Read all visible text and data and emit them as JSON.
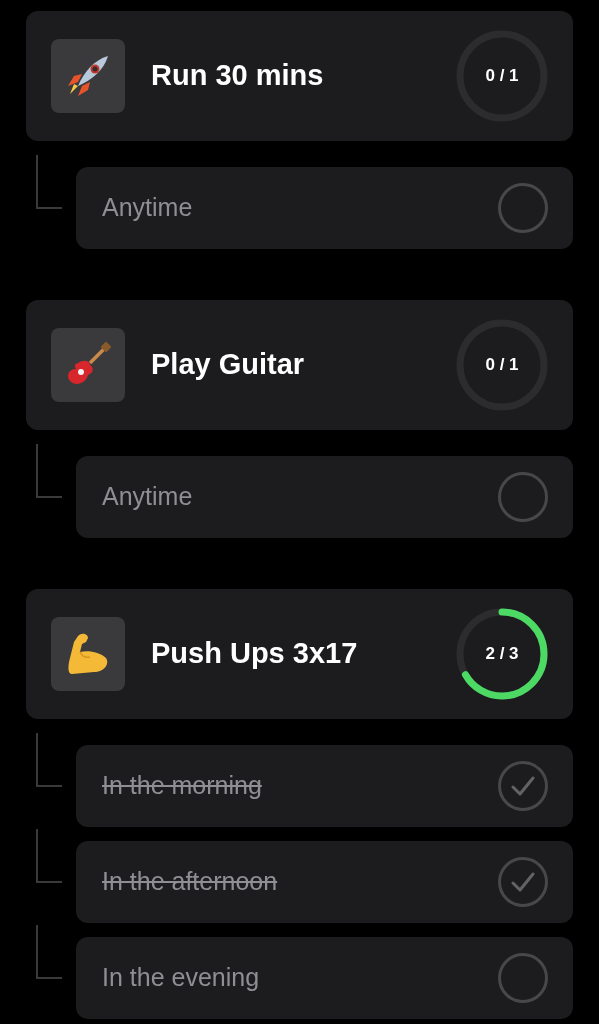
{
  "habits": [
    {
      "title": "Run 30 mins",
      "progress": "0 / 1",
      "slots": [
        {
          "label": "Anytime",
          "checked": false
        }
      ]
    },
    {
      "title": "Play Guitar",
      "progress": "0 / 1",
      "slots": [
        {
          "label": "Anytime",
          "checked": false
        }
      ]
    },
    {
      "title": "Push Ups 3x17",
      "progress": "2 / 3",
      "slots": [
        {
          "label": "In the morning",
          "checked": true
        },
        {
          "label": "In the afternoon",
          "checked": true
        },
        {
          "label": "In the evening",
          "checked": false
        }
      ]
    }
  ]
}
